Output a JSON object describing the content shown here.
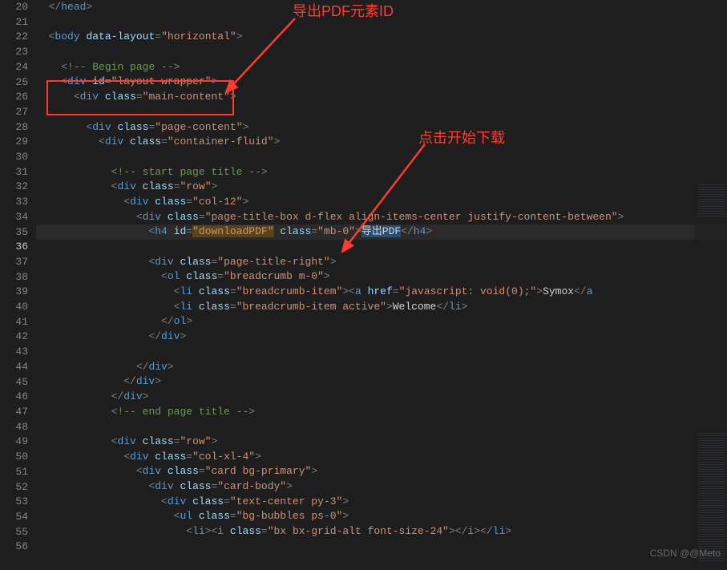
{
  "gutter": {
    "start": 20,
    "end": 56,
    "active": 36
  },
  "annotations": {
    "label_top": "导出PDF元素ID",
    "label_mid": "点击开始下载"
  },
  "watermark": "CSDN @@Meto",
  "code": {
    "l20": {
      "close_tag": "head"
    },
    "l22_attr": "data-layout",
    "l22_val": "\"horizontal\"",
    "l24_cmt": "!-- Begin page --",
    "l25_attr": "id",
    "l25_val": "\"layout-wrapper\"",
    "l26_val": "\"main-content\"",
    "l28_val": "\"page-content\"",
    "l29_val": "\"container-fluid\"",
    "l31_cmt": "!-- start page title --",
    "l32_val": "\"row\"",
    "l33_val": "\"col-12\"",
    "l34_val": "\"page-title-box d-flex align-items-center justify-content-between\"",
    "l35_idval": "\"downloadPDF\"",
    "l35_classval": "\"mb-0\"",
    "l35_text": "导出PDF",
    "l37_val": "\"page-title-right\"",
    "l38_val": "\"breadcrumb m-0\"",
    "l39_val": "\"breadcrumb-item\"",
    "l39_href": "\"javascript: void(0);\"",
    "l39_text": "Symox",
    "l40_val": "\"breadcrumb-item active\"",
    "l40_text": "Welcome",
    "l47_cmt": "!-- end page title --",
    "l49_val": "\"row\"",
    "l50_val": "\"col-xl-4\"",
    "l51_val": "\"card bg-primary\"",
    "l52_val": "\"card-body\"",
    "l53_val": "\"text-center py-3\"",
    "l54_val": "\"bg-bubbles ps-0\"",
    "l55_val": "\"bx bx-grid-alt font-size-24\""
  }
}
